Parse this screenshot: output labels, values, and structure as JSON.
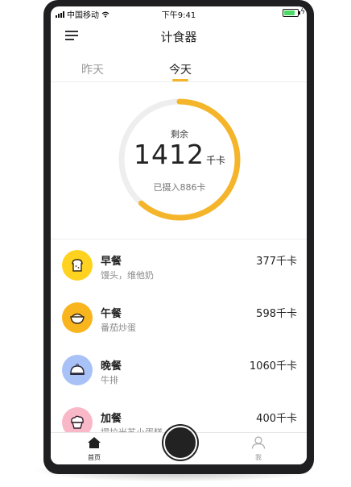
{
  "status_bar": {
    "carrier": "中国移动",
    "time": "下午9:41"
  },
  "nav": {
    "title": "计食器",
    "menu_icon": "hamburger-menu-icon"
  },
  "tabs": [
    {
      "label": "昨天",
      "active": false
    },
    {
      "label": "今天",
      "active": true
    }
  ],
  "summary": {
    "remaining_label": "剩余",
    "remaining_value": "1412",
    "remaining_unit": "千卡",
    "consumed_text": "已摄入886卡",
    "consumed": 886,
    "remaining": 1412,
    "progress_color": "#f5b52a",
    "track_color": "#eeeeee"
  },
  "meals": [
    {
      "name": "早餐",
      "foods": "馒头，维他奶",
      "calories": "377千卡",
      "icon": "toast-bread-icon",
      "color": "#ffd21f"
    },
    {
      "name": "午餐",
      "foods": "番茄炒蛋",
      "calories": "598千卡",
      "icon": "rice-bowl-icon",
      "color": "#f9b51e"
    },
    {
      "name": "晚餐",
      "foods": "牛排",
      "calories": "1060千卡",
      "icon": "food-cloche-icon",
      "color": "#a8c2f7"
    },
    {
      "name": "加餐",
      "foods": "提拉米苏小蛋糕",
      "calories": "400千卡",
      "icon": "muffin-icon",
      "color": "#f9b8c8"
    }
  ],
  "tabbar": {
    "home_label": "首页",
    "me_label": "我",
    "home_icon": "home-icon",
    "me_icon": "user-icon"
  }
}
